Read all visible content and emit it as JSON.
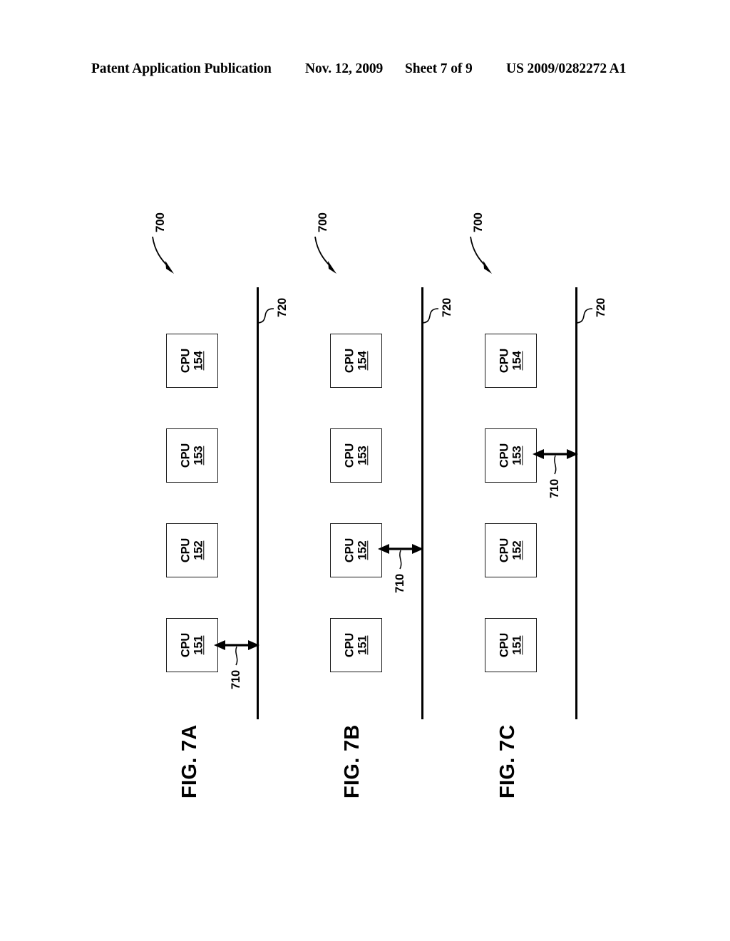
{
  "header": {
    "publication": "Patent Application Publication",
    "date": "Nov. 12, 2009",
    "sheet": "Sheet 7 of 9",
    "patent_number": "US 2009/0282272 A1"
  },
  "refs": {
    "system": "700",
    "gap": "710",
    "bus": "720"
  },
  "cpu": {
    "label": "CPU",
    "ids": [
      "151",
      "152",
      "153",
      "154"
    ]
  },
  "panels": [
    {
      "figure_label": "FIG. 7A",
      "system_ref": "700",
      "bus_ref": "720",
      "gap_ref": "710",
      "gap_at_cpu": "151",
      "cpus": [
        {
          "label": "CPU",
          "id": "151"
        },
        {
          "label": "CPU",
          "id": "152"
        },
        {
          "label": "CPU",
          "id": "153"
        },
        {
          "label": "CPU",
          "id": "154"
        }
      ]
    },
    {
      "figure_label": "FIG. 7B",
      "system_ref": "700",
      "bus_ref": "720",
      "gap_ref": "710",
      "gap_at_cpu": "152",
      "cpus": [
        {
          "label": "CPU",
          "id": "151"
        },
        {
          "label": "CPU",
          "id": "152"
        },
        {
          "label": "CPU",
          "id": "153"
        },
        {
          "label": "CPU",
          "id": "154"
        }
      ]
    },
    {
      "figure_label": "FIG. 7C",
      "system_ref": "700",
      "bus_ref": "720",
      "gap_ref": "710",
      "gap_at_cpu": "153",
      "cpus": [
        {
          "label": "CPU",
          "id": "151"
        },
        {
          "label": "CPU",
          "id": "152"
        },
        {
          "label": "CPU",
          "id": "153"
        },
        {
          "label": "CPU",
          "id": "154"
        }
      ]
    }
  ],
  "colors": {
    "ink": "#000000",
    "paper": "#ffffff",
    "box_stroke": "#1a1a1a"
  }
}
